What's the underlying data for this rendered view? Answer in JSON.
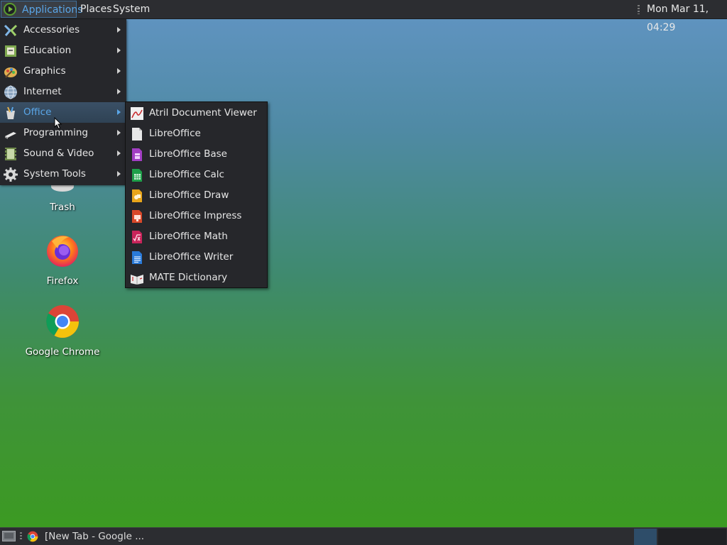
{
  "top_panel": {
    "applications_label": "Applications",
    "places_label": "Places",
    "system_label": "System",
    "clock": "Mon Mar 11, 04:29"
  },
  "applications_menu": {
    "items": [
      {
        "label": "Accessories",
        "icon": "accessories-icon"
      },
      {
        "label": "Education",
        "icon": "education-icon"
      },
      {
        "label": "Graphics",
        "icon": "graphics-icon"
      },
      {
        "label": "Internet",
        "icon": "internet-icon"
      },
      {
        "label": "Office",
        "icon": "office-icon",
        "active": true
      },
      {
        "label": "Programming",
        "icon": "programming-icon"
      },
      {
        "label": "Sound & Video",
        "icon": "sound-video-icon"
      },
      {
        "label": "System Tools",
        "icon": "system-tools-icon"
      }
    ]
  },
  "office_submenu": {
    "items": [
      {
        "label": "Atril Document Viewer",
        "icon": "atril-icon"
      },
      {
        "label": "LibreOffice",
        "icon": "libreoffice-icon"
      },
      {
        "label": "LibreOffice Base",
        "icon": "libreoffice-base-icon"
      },
      {
        "label": "LibreOffice Calc",
        "icon": "libreoffice-calc-icon"
      },
      {
        "label": "LibreOffice Draw",
        "icon": "libreoffice-draw-icon"
      },
      {
        "label": "LibreOffice Impress",
        "icon": "libreoffice-impress-icon"
      },
      {
        "label": "LibreOffice Math",
        "icon": "libreoffice-math-icon"
      },
      {
        "label": "LibreOffice Writer",
        "icon": "libreoffice-writer-icon"
      },
      {
        "label": "MATE Dictionary",
        "icon": "dictionary-icon"
      }
    ]
  },
  "desktop_icons": {
    "trash": "Trash",
    "firefox": "Firefox",
    "chrome": "Google Chrome"
  },
  "taskbar": {
    "window_title": "[New Tab - Google ..."
  },
  "colors": {
    "accent": "#5aa6e8",
    "panel": "#2c2d31",
    "menu_bg": "#26272b"
  }
}
